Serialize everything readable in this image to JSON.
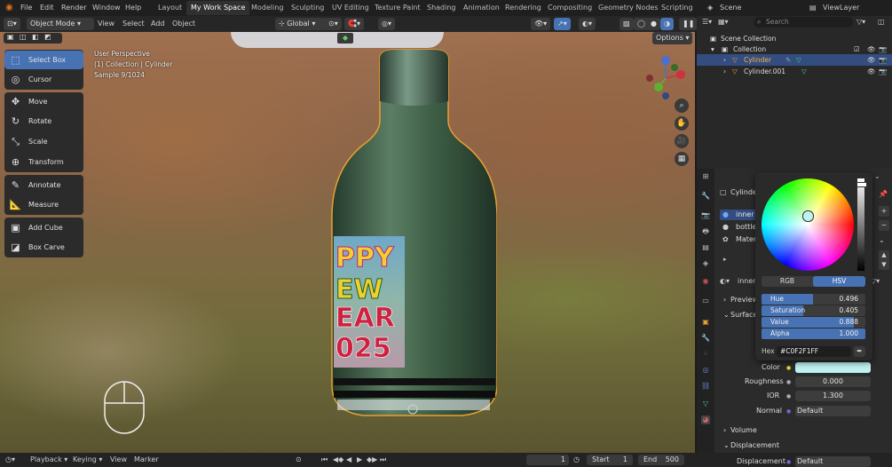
{
  "menu": {
    "file": "File",
    "edit": "Edit",
    "render": "Render",
    "window": "Window",
    "help": "Help"
  },
  "workspaces": [
    "Layout",
    "My Work Space",
    "Modeling",
    "Sculpting",
    "UV Editing",
    "Texture Paint",
    "Shading",
    "Animation",
    "Rendering",
    "Compositing",
    "Geometry Nodes",
    "Scripting"
  ],
  "active_workspace": "My Work Space",
  "scene": {
    "label": "Scene",
    "view_layer": "ViewLayer"
  },
  "viewport_header": {
    "mode": "Object Mode",
    "view": "View",
    "select": "Select",
    "add": "Add",
    "object": "Object",
    "orientation": "Global",
    "options": "Options"
  },
  "viewport_info": {
    "line1": "User Perspective",
    "line2": "(1) Collection | Cylinder",
    "line3": "Sample 9/1024"
  },
  "tools": [
    {
      "label": "Select Box",
      "icon": "select-box-icon",
      "glyph": "⬚",
      "selected": true
    },
    {
      "label": "Cursor",
      "icon": "cursor-icon",
      "glyph": "◎",
      "selected": false
    },
    {
      "label": "Move",
      "icon": "move-icon",
      "glyph": "✥",
      "selected": false
    },
    {
      "label": "Rotate",
      "icon": "rotate-icon",
      "glyph": "↻",
      "selected": false
    },
    {
      "label": "Scale",
      "icon": "scale-icon",
      "glyph": "⤡",
      "selected": false
    },
    {
      "label": "Transform",
      "icon": "transform-icon",
      "glyph": "⊕",
      "selected": false
    },
    {
      "label": "Annotate",
      "icon": "annotate-icon",
      "glyph": "✎",
      "selected": false
    },
    {
      "label": "Measure",
      "icon": "measure-icon",
      "glyph": "📐",
      "selected": false
    },
    {
      "label": "Add Cube",
      "icon": "add-cube-icon",
      "glyph": "▣",
      "selected": false
    },
    {
      "label": "Box Carve",
      "icon": "box-carve-icon",
      "glyph": "◪",
      "selected": false
    }
  ],
  "label_text": {
    "l1": "PPY",
    "l2": "EW",
    "l3": "EAR",
    "l4": "025"
  },
  "outliner": {
    "search_placeholder": "Search",
    "rows": [
      {
        "label": "Scene Collection"
      },
      {
        "label": "Collection"
      },
      {
        "label": "Cylinder",
        "selected": true
      },
      {
        "label": "Cylinder.001",
        "selected": false
      }
    ]
  },
  "properties": {
    "object_name": "Cylinder",
    "slots": [
      "inner",
      "bottle",
      "Mater"
    ],
    "material_name": "inner",
    "preview": "Preview",
    "surface": "Surface",
    "color_label": "Color",
    "color_value": "#C0F2F1",
    "roughness_label": "Roughness",
    "roughness": "0.000",
    "ior_label": "IOR",
    "ior": "1.300",
    "normal_label": "Normal",
    "normal": "Default",
    "volume": "Volume",
    "displacement_section": "Displacement",
    "displacement_label": "Displacement",
    "displacement": "Default"
  },
  "color_picker": {
    "mode_rgb": "RGB",
    "mode_hsv": "HSV",
    "active_mode": "HSV",
    "hue_label": "Hue",
    "hue": "0.496",
    "hue_frac": 0.496,
    "sat_label": "Saturation",
    "sat": "0.405",
    "sat_frac": 0.405,
    "val_label": "Value",
    "val": "0.888",
    "val_frac": 0.888,
    "alpha_label": "Alpha",
    "alpha": "1.000",
    "alpha_frac": 1.0,
    "hex_label": "Hex",
    "hex": "#C0F2F1FF"
  },
  "timeline": {
    "playback": "Playback",
    "keying": "Keying",
    "view": "View",
    "marker": "Marker",
    "current_frame": "1",
    "start_label": "Start",
    "start": "1",
    "end_label": "End",
    "end": "500"
  },
  "colors": {
    "accent": "#4772B3",
    "selection": "#E8A030",
    "background": "#1D1D1D"
  }
}
